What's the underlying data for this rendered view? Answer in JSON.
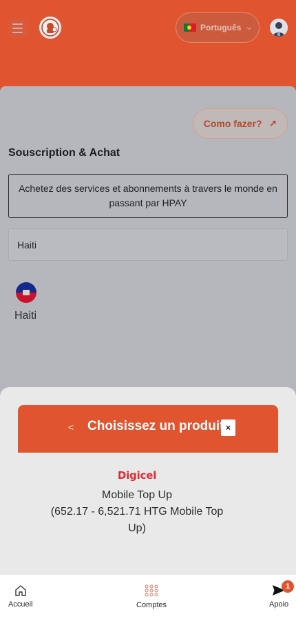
{
  "header": {
    "language": {
      "label": "Português",
      "flag": "portugal-flag-icon"
    },
    "menu_icon": "hamburger-menu-icon",
    "logo_icon": "hpay-logo-icon",
    "avatar_icon": "user-avatar-icon"
  },
  "main": {
    "how_to_label": "Como fazer?",
    "how_to_icon": "↗",
    "section_title": "Souscription & Achat",
    "info_text": "Achetez des services et abonnements à travers le monde en passant par HPAY",
    "country_input_value": "Haiti",
    "countries": [
      {
        "name": "Haiti",
        "flag": "haiti-flag-icon"
      }
    ]
  },
  "sheet": {
    "back_label": "<",
    "title": "Choisissez un produit",
    "close_label": "×",
    "products": [
      {
        "brand": "Digicel",
        "name": "Mobile Top Up",
        "range": "(652.17 - 6,521.71 HTG Mobile Top Up)"
      }
    ]
  },
  "bottom_nav": {
    "items": [
      {
        "label": "Accueil",
        "icon": "home-icon"
      },
      {
        "label": "Comptes",
        "icon": "grid-icon"
      },
      {
        "label": "Apoio",
        "icon": "send-icon",
        "badge": "1"
      }
    ]
  },
  "colors": {
    "accent": "#e0552f",
    "overlay": "#b5b7bd",
    "sheet": "#e9e9ea"
  }
}
